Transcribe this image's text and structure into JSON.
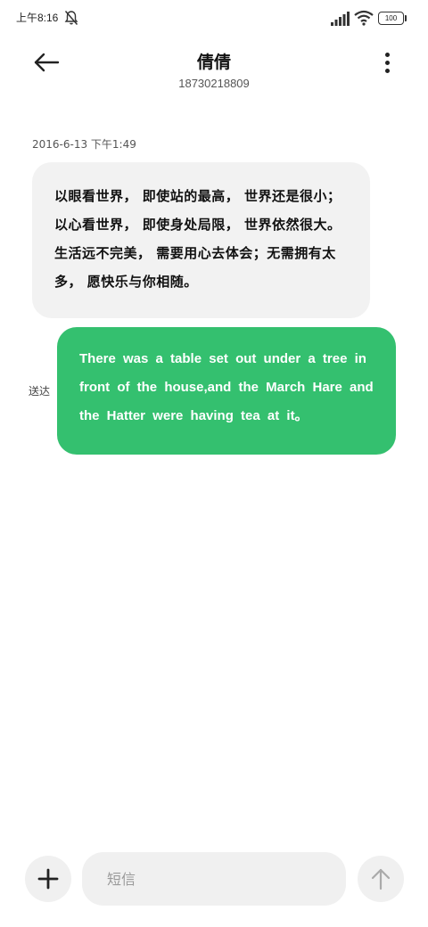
{
  "status_bar": {
    "time": "上午8:16",
    "battery": "100",
    "icons": [
      "mute-notification-icon",
      "signal-icon",
      "wifi-icon",
      "battery-icon"
    ]
  },
  "header": {
    "title": "倩倩",
    "subtitle": "18730218809",
    "back_icon": "arrow-left-icon",
    "more_icon": "more-vertical-icon"
  },
  "messages": [
    {
      "direction": "incoming",
      "timestamp": "2016-6-13  下午1:49",
      "text": "以眼看世界， 即使站的最高， 世界还是很小；以心看世界， 即使身处局限， 世界依然很大。 生活远不完美， 需要用心去体会；无需拥有太多， 愿快乐与你相随。"
    },
    {
      "direction": "outgoing",
      "text": "There was a table set out under a tree in front of the house,and the March Hare and the Hatter were having tea at it。",
      "status": "送达"
    }
  ],
  "input_bar": {
    "placeholder": "短信",
    "add_icon": "plus-icon",
    "send_icon": "arrow-up-icon"
  },
  "colors": {
    "outgoing_bubble": "#34c06f",
    "incoming_bubble": "#f2f2f2",
    "input_background": "#f0f0f0"
  }
}
